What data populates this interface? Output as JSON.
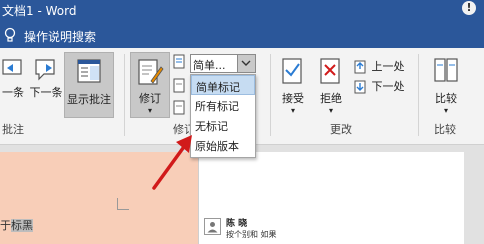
{
  "titlebar": {
    "title": "文档1 - Word",
    "warning_glyph": "!"
  },
  "tellme": {
    "label": "操作说明搜索",
    "icon": "lightbulb-icon"
  },
  "ribbon": {
    "buttons": {
      "yitiao": "一条",
      "xiayitiao": "下一条",
      "show_comments": "显示批注",
      "track_changes": "修订",
      "accept": "接受",
      "reject": "拒绝",
      "previous": "上一处",
      "next": "下一处",
      "compare": "比较"
    },
    "groups": {
      "comments": "批注",
      "tracking": "修订",
      "changes": "更改",
      "compare": "比较"
    },
    "markup_combo": {
      "value": "简单..."
    },
    "markup_options": [
      "简单标记",
      "所有标记",
      "无标记",
      "原始版本"
    ]
  },
  "document": {
    "text_prefix": "于",
    "selected_text": "标黑",
    "comment_author": "陈 晓",
    "comment_text": "按个别和  如果"
  },
  "colors": {
    "title_blue": "#2b579a",
    "arrow_red": "#d11a1a",
    "page_fill": "#f8ceb8"
  }
}
